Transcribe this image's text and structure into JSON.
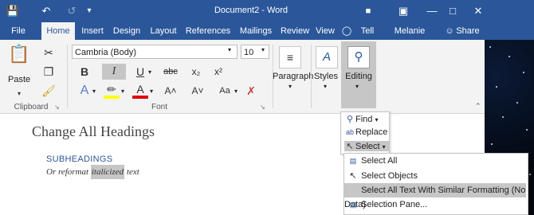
{
  "window": {
    "title": "Document2 - Word",
    "controls": [
      "minimize-icon",
      "maximize-icon",
      "close-icon"
    ]
  },
  "quick_access": [
    "save-icon",
    "undo-icon",
    "redo-icon"
  ],
  "tabs": [
    {
      "label": "File"
    },
    {
      "label": "Home"
    },
    {
      "label": "Insert"
    },
    {
      "label": "Design"
    },
    {
      "label": "Layout"
    },
    {
      "label": "References"
    },
    {
      "label": "Mailings"
    },
    {
      "label": "Review"
    },
    {
      "label": "View"
    }
  ],
  "tell_me": "Tell me",
  "user": "Melanie P...",
  "share": "Share",
  "ribbon": {
    "clipboard": {
      "paste": "Paste",
      "label": "Clipboard"
    },
    "font": {
      "name": "Cambria (Body)",
      "size": "10",
      "label": "Font",
      "bold": "B",
      "italic": "I",
      "underline": "U",
      "strike": "abc",
      "subscript": "x₂",
      "superscript": "x²",
      "grow": "A˄",
      "shrink": "A˅",
      "case": "Aa",
      "clear": "A"
    },
    "paragraph": {
      "label": "Paragraph"
    },
    "styles": {
      "label": "Styles"
    },
    "editing": {
      "label": "Editing"
    }
  },
  "document": {
    "heading": "Change All Headings",
    "subheading": "SUBHEADINGS",
    "line_before": "Or reformat ",
    "line_selected": "italicized",
    "line_after": " text"
  },
  "editing_menu": {
    "find": "Find",
    "replace": "Replace",
    "select": "Select"
  },
  "select_menu": [
    "Select All",
    "Select Objects",
    "Select All Text With Similar Formatting (No Data)",
    "Selection Pane..."
  ]
}
